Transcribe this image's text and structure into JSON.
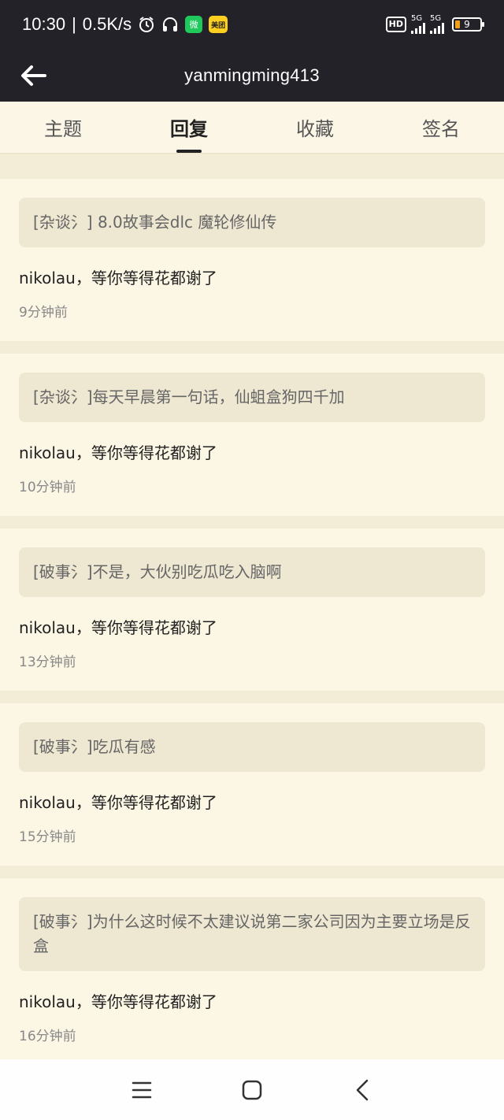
{
  "status_bar": {
    "time": "10:30",
    "speed": "0.5K/s",
    "wechat_badge": "微",
    "meituan_badge": "美团",
    "hd_badge": "HD",
    "net1": "5G",
    "net2": "5G",
    "battery": "9",
    "colors": {
      "battery_fill": "#f0a11b",
      "wechat": "#1fc95c",
      "meituan": "#ffcf1f"
    }
  },
  "header": {
    "title": "yanmingming413",
    "back_icon": "arrow-left-icon"
  },
  "tabs": [
    {
      "label": "主题",
      "active": false
    },
    {
      "label": "回复",
      "active": true
    },
    {
      "label": "收藏",
      "active": false
    },
    {
      "label": "签名",
      "active": false
    }
  ],
  "replies": [
    {
      "topic": "[杂谈氵] 8.0故事会dlc 魔轮修仙传",
      "text": "nikolau，等你等得花都谢了",
      "time": "9分钟前"
    },
    {
      "topic": "[杂谈氵]每天早晨第一句话，仙蛆盒狗四千加",
      "text": "nikolau，等你等得花都谢了",
      "time": "10分钟前"
    },
    {
      "topic": "[破事氵]不是，大伙别吃瓜吃入脑啊",
      "text": "nikolau，等你等得花都谢了",
      "time": "13分钟前"
    },
    {
      "topic": "[破事氵]吃瓜有感",
      "text": "nikolau，等你等得花都谢了",
      "time": "15分钟前"
    },
    {
      "topic": "[破事氵]为什么这时候不太建议说第二家公司因为主要立场是反盒",
      "text": "nikolau，等你等得花都谢了",
      "time": "16分钟前"
    }
  ],
  "navbar": {
    "menu_icon": "menu-icon",
    "home_icon": "home-icon",
    "back_icon": "back-icon"
  }
}
